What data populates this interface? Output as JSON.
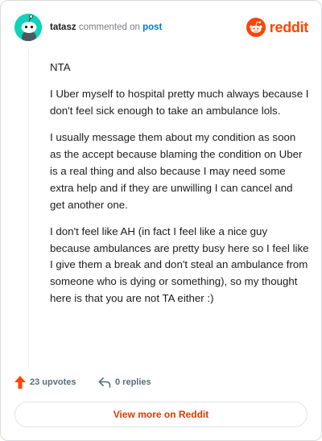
{
  "comment": {
    "username": "tatasz",
    "action_text": "commented on",
    "post_link": "post",
    "paragraphs": [
      "NTA",
      "I Uber myself to hospital pretty much always because I don't feel sick enough to take an ambulance lols.",
      "I usually message them about my condition as soon as the accept because blaming the condition on Uber is a real thing and also because I may need some extra help and if they are unwilling I can cancel and get another one.",
      "I don't feel like AH (in fact I feel like a nice guy because ambulances are pretty busy here so I feel like I give them a break and don't steal an ambulance from someone who is dying or something), so my thought here is that you are not TA either :)"
    ]
  },
  "logo": {
    "text": "reddit",
    "icon": "reddit-snoo-icon"
  },
  "stats": {
    "upvotes": "23 upvotes",
    "upvote_icon": "upvote-arrow-icon",
    "replies": "0 replies",
    "reply_icon": "reply-arrow-icon"
  },
  "cta": {
    "label": "View more on Reddit"
  },
  "colors": {
    "brand": "#ff4500",
    "link": "#0079d3",
    "avatar": "#0dd3bb",
    "cta_text": "#d93a00"
  }
}
